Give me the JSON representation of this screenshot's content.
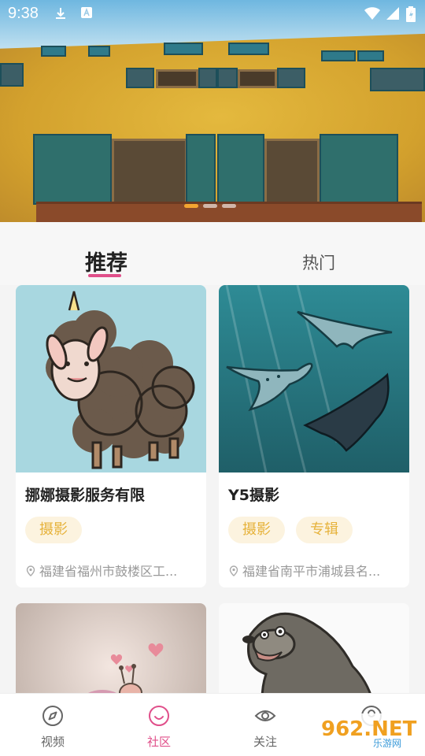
{
  "status_bar": {
    "time": "9:38",
    "icons": [
      "download-icon",
      "app-notification-icon",
      "wifi-icon",
      "signal-icon",
      "battery-icon"
    ]
  },
  "banner": {
    "dot_count": 3,
    "active_dot": 0
  },
  "tabs": [
    {
      "label": "推荐",
      "active": true
    },
    {
      "label": "热门",
      "active": false
    }
  ],
  "cards": [
    {
      "title": "挪娜摄影服务有限",
      "tags": [
        "摄影"
      ],
      "location": "福建省福州市鼓楼区工..."
    },
    {
      "title": "Y5摄影",
      "tags": [
        "摄影",
        "专辑"
      ],
      "location": "福建省南平市浦城县名..."
    },
    {
      "title": "",
      "tags": [],
      "location": ""
    },
    {
      "title": "",
      "tags": [],
      "location": ""
    }
  ],
  "bottom_nav": [
    {
      "label": "视频",
      "icon": "compass-icon",
      "active": false
    },
    {
      "label": "社区",
      "icon": "smile-icon",
      "active": true
    },
    {
      "label": "关注",
      "icon": "eye-icon",
      "active": false
    },
    {
      "label": "",
      "icon": "profile-icon",
      "active": false
    }
  ],
  "watermark": {
    "text": "962.NET",
    "subtext": "乐游网"
  },
  "colors": {
    "accent": "#e04f8a",
    "tag_text": "#e6b23a",
    "tag_bg": "#fcf3df",
    "active_dot": "#f3a531"
  }
}
